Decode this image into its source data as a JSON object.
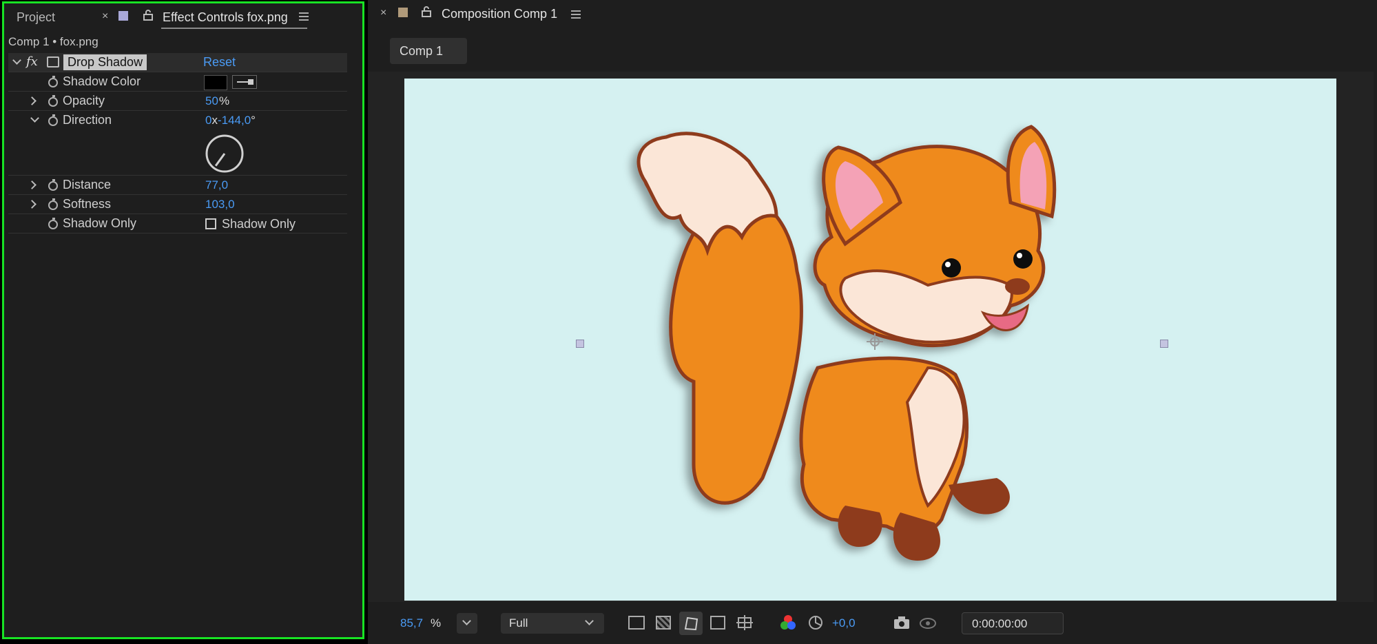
{
  "left_panel": {
    "tabs": {
      "project": "Project",
      "effect_controls": "Effect Controls fox.png"
    },
    "breadcrumb": "Comp 1 • fox.png",
    "effect": {
      "fx_label": "fx",
      "name": "Drop Shadow",
      "reset": "Reset",
      "properties": {
        "shadow_color": {
          "label": "Shadow Color",
          "color": "#000000"
        },
        "opacity": {
          "label": "Opacity",
          "value": "50",
          "unit": "%"
        },
        "direction": {
          "label": "Direction",
          "revolutions": "0",
          "separator": "x",
          "degrees": "-144,0",
          "unit": "°",
          "dial_angle_deg": -144
        },
        "distance": {
          "label": "Distance",
          "value": "77,0"
        },
        "softness": {
          "label": "Softness",
          "value": "103,0"
        },
        "shadow_only": {
          "label": "Shadow Only",
          "checkbox_label": "Shadow Only",
          "checked": false
        }
      }
    }
  },
  "right_panel": {
    "tab_title": "Composition Comp 1",
    "comp_button": "Comp 1",
    "bottom_bar": {
      "zoom_value": "85,7",
      "zoom_unit": "%",
      "resolution": "Full",
      "exposure": "+0,0",
      "timecode": "0:00:00:00"
    },
    "canvas_color": "#d5f1f1"
  },
  "colors": {
    "highlight_border": "#18e324",
    "accent_blue": "#4a9bf5",
    "panel_bg": "#1e1e1e"
  }
}
